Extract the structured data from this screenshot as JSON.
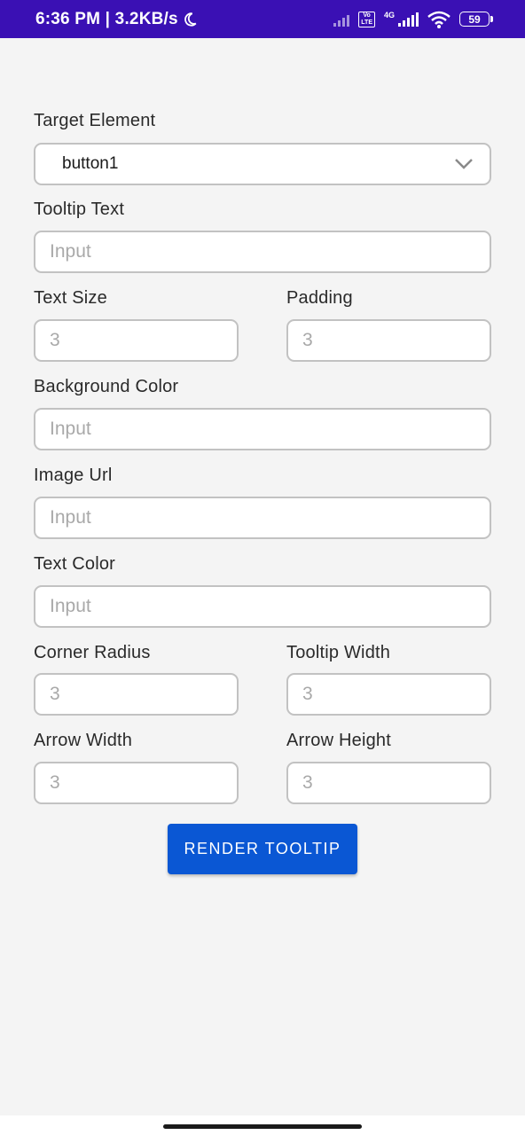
{
  "status_bar": {
    "time_speed": "6:36 PM | 3.2KB/s",
    "volte_top": "Vo",
    "volte_bottom": "LTE",
    "network": "4G",
    "battery": "59"
  },
  "form": {
    "target_element": {
      "label": "Target Element",
      "value": "button1"
    },
    "tooltip_text": {
      "label": "Tooltip Text",
      "placeholder": "Input"
    },
    "text_size": {
      "label": "Text Size",
      "placeholder": "3"
    },
    "padding": {
      "label": "Padding",
      "placeholder": "3"
    },
    "background_color": {
      "label": "Background Color",
      "placeholder": "Input"
    },
    "image_url": {
      "label": "Image Url",
      "placeholder": "Input"
    },
    "text_color": {
      "label": "Text Color",
      "placeholder": "Input"
    },
    "corner_radius": {
      "label": "Corner Radius",
      "placeholder": "3"
    },
    "tooltip_width": {
      "label": "Tooltip Width",
      "placeholder": "3"
    },
    "arrow_width": {
      "label": "Arrow Width",
      "placeholder": "3"
    },
    "arrow_height": {
      "label": "Arrow Height",
      "placeholder": "3"
    }
  },
  "actions": {
    "render_label": "RENDER TOOLTIP"
  },
  "colors": {
    "status_bar": "#3a10b4",
    "accent": "#0a57d4",
    "background": "#f4f4f4"
  }
}
